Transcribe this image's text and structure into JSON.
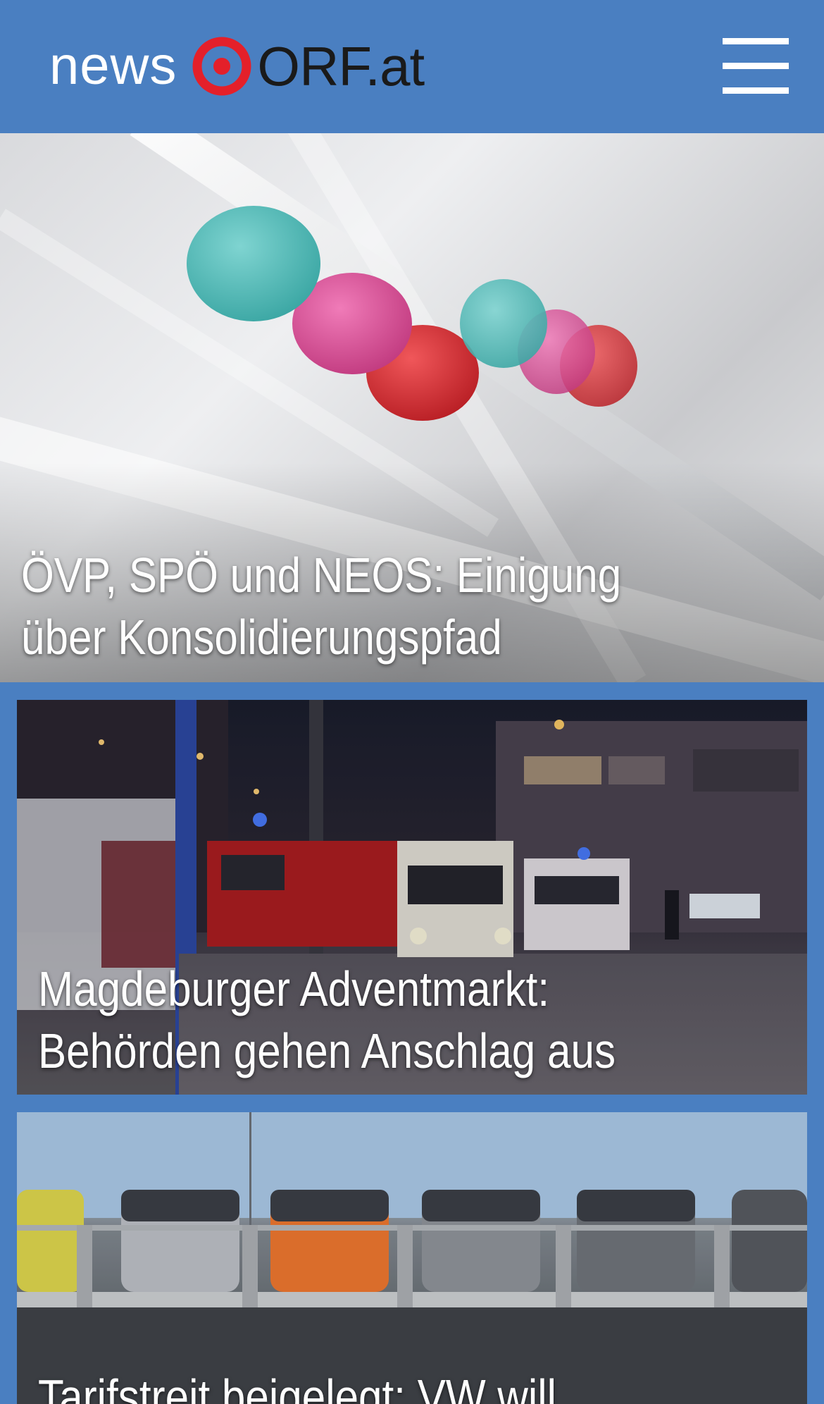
{
  "header": {
    "logo_news": "news",
    "logo_orf": "ORF.at",
    "brand_color": "#4a7fc1",
    "logo_mark_color": "#e4202a",
    "menu_icon": "hamburger-menu-icon"
  },
  "articles": [
    {
      "title": "ÖVP, SPÖ und NEOS: Einigung über Konsolidierungspfad",
      "image": "colorful-beads-on-glass-rods"
    },
    {
      "title": "Magdeburger Adventmarkt: Behörden gehen Anschlag aus",
      "image": "emergency-vehicles-at-night-market"
    },
    {
      "title": "Tarifstreit beigelegt: VW will",
      "image": "vw-cars-in-parking-rack"
    }
  ]
}
